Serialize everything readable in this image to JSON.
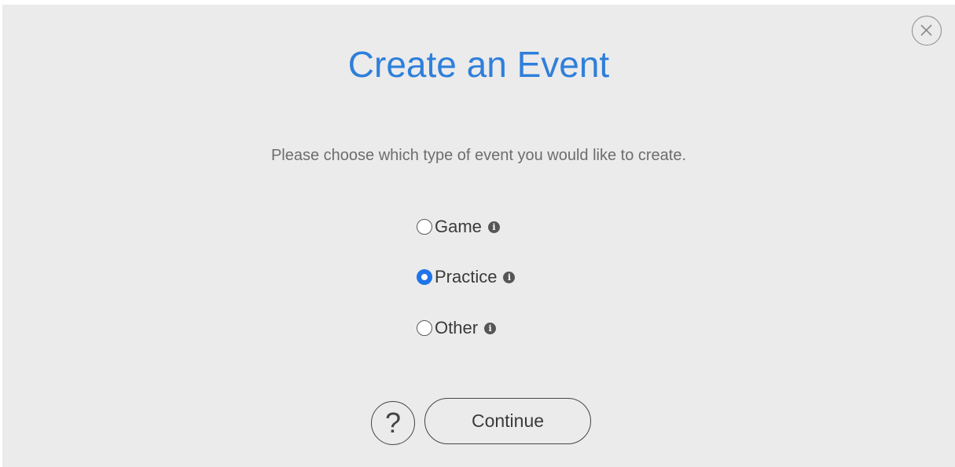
{
  "dialog": {
    "title": "Create an Event",
    "subtitle": "Please choose which type of event you would like to create.",
    "close_icon": "close-circle-icon"
  },
  "options": [
    {
      "label": "Game",
      "selected": false,
      "info_icon": "info-icon",
      "info_glyph": "i"
    },
    {
      "label": "Practice",
      "selected": true,
      "info_icon": "info-icon",
      "info_glyph": "i"
    },
    {
      "label": "Other",
      "selected": false,
      "info_icon": "info-icon",
      "info_glyph": "i"
    }
  ],
  "footer": {
    "help_glyph": "?",
    "continue_label": "Continue"
  },
  "colors": {
    "accent": "#2f7fdb",
    "radio_selected": "#1f74e8",
    "background": "#ebebeb"
  }
}
